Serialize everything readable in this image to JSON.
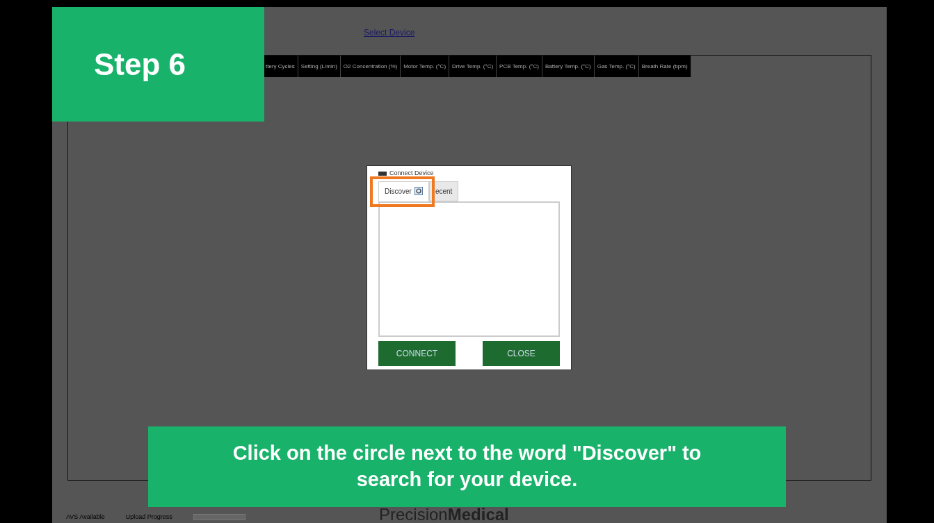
{
  "app": {
    "select_device_link": "Select Device",
    "table": {
      "columns": [
        "ttery Cycles",
        "Setting (L/min)",
        "O2 Concentration (%)",
        "Motor Temp. (°C)",
        "Drive Temp. (°C)",
        "PCB Temp. (°C)",
        "Battery Temp. (°C)",
        "Gas Temp. (°C)",
        "Breath Rate (bpm)"
      ]
    },
    "footer": {
      "avs_label": "AVS Available",
      "upload_label": "Upload Progress",
      "upload_progress": {
        "level": 0
      },
      "logo": "Precision**Medical**"
    }
  },
  "dialog": {
    "title": "Connect Device",
    "tabs": [
      {
        "label": "Discover",
        "selected": true
      },
      {
        "label": "ecent",
        "selected": false
      }
    ],
    "buttons": [
      "CONNECT",
      "CLOSE"
    ]
  },
  "overlay": {
    "step_label": "Step 6",
    "caption": "Click on the circle next to the word \"Discover\" to search for your device."
  }
}
